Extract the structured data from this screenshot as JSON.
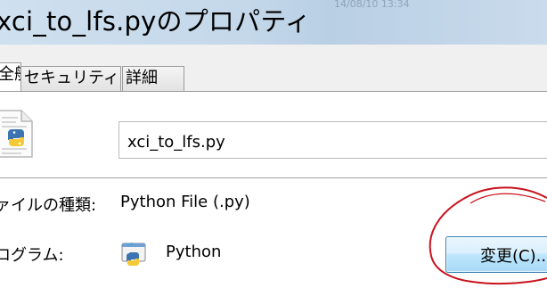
{
  "window": {
    "title": "xci_to_lfs.pyのプロパティ",
    "background_text": "14/08/10 13:34"
  },
  "tabs": [
    {
      "label": "全般"
    },
    {
      "label": "セキュリティ"
    },
    {
      "label": "詳細"
    }
  ],
  "general": {
    "file_name": "xci_to_lfs.py",
    "file_type_label": "ファイルの種類:",
    "file_type_value": "Python File (.py)",
    "program_label": "プログラム:",
    "program_value": "Python",
    "change_button": "変更(C)..."
  },
  "colors": {
    "titlebar": "#c4d8ea",
    "annotation_circle": "#c8121c",
    "button_border": "#3c7fb1"
  },
  "icons": {
    "file": "python-file-icon",
    "program": "python-launcher-icon"
  }
}
